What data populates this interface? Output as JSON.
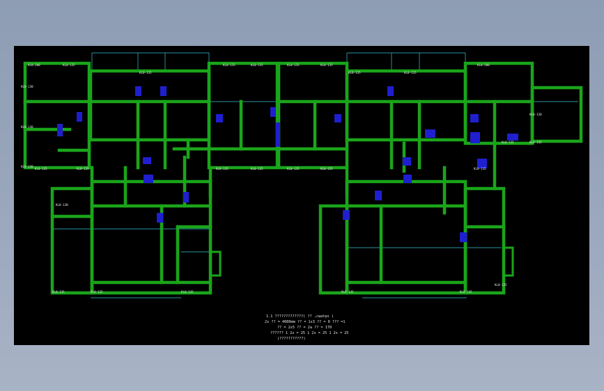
{
  "drawing": {
    "background": "#000000",
    "wall_color": "#1aa51a",
    "column_color": "#1f1fd0",
    "axis_color": "#39c6d6",
    "text_color": "#e8e8e8"
  },
  "notes": [
    "1.1 ?????????????( ?? ,cwatps )",
    "2s ?? = 4000mm ?? = 1s3 ?? = 0  ??? =1",
    "?? = 2s5   ?? = 2a ?? = 170",
    "?????? 1 2s = 25  1 2s = 25  1 2s = 25",
    "(???????????)"
  ],
  "labels": [
    "KL0-200",
    "KL0-135",
    "KL0-135",
    "KL0-135",
    "KL0-135",
    "KL0-135",
    "KL0-135",
    "KL0-135",
    "KL0-135",
    "KL0-200",
    "KL0-130",
    "KL0-130",
    "KL0-130",
    "KL0-130",
    "KL0-130",
    "KL0-135",
    "KL0-135",
    "KL0-135",
    "KL0-135",
    "KL0-135",
    "KL0-135",
    "KL0-135",
    "KL0-135",
    "KL0-135",
    "KL0-135",
    "KL0-135",
    "KL0-135",
    "KL0-135",
    "KL0-135",
    "KL0-135"
  ]
}
